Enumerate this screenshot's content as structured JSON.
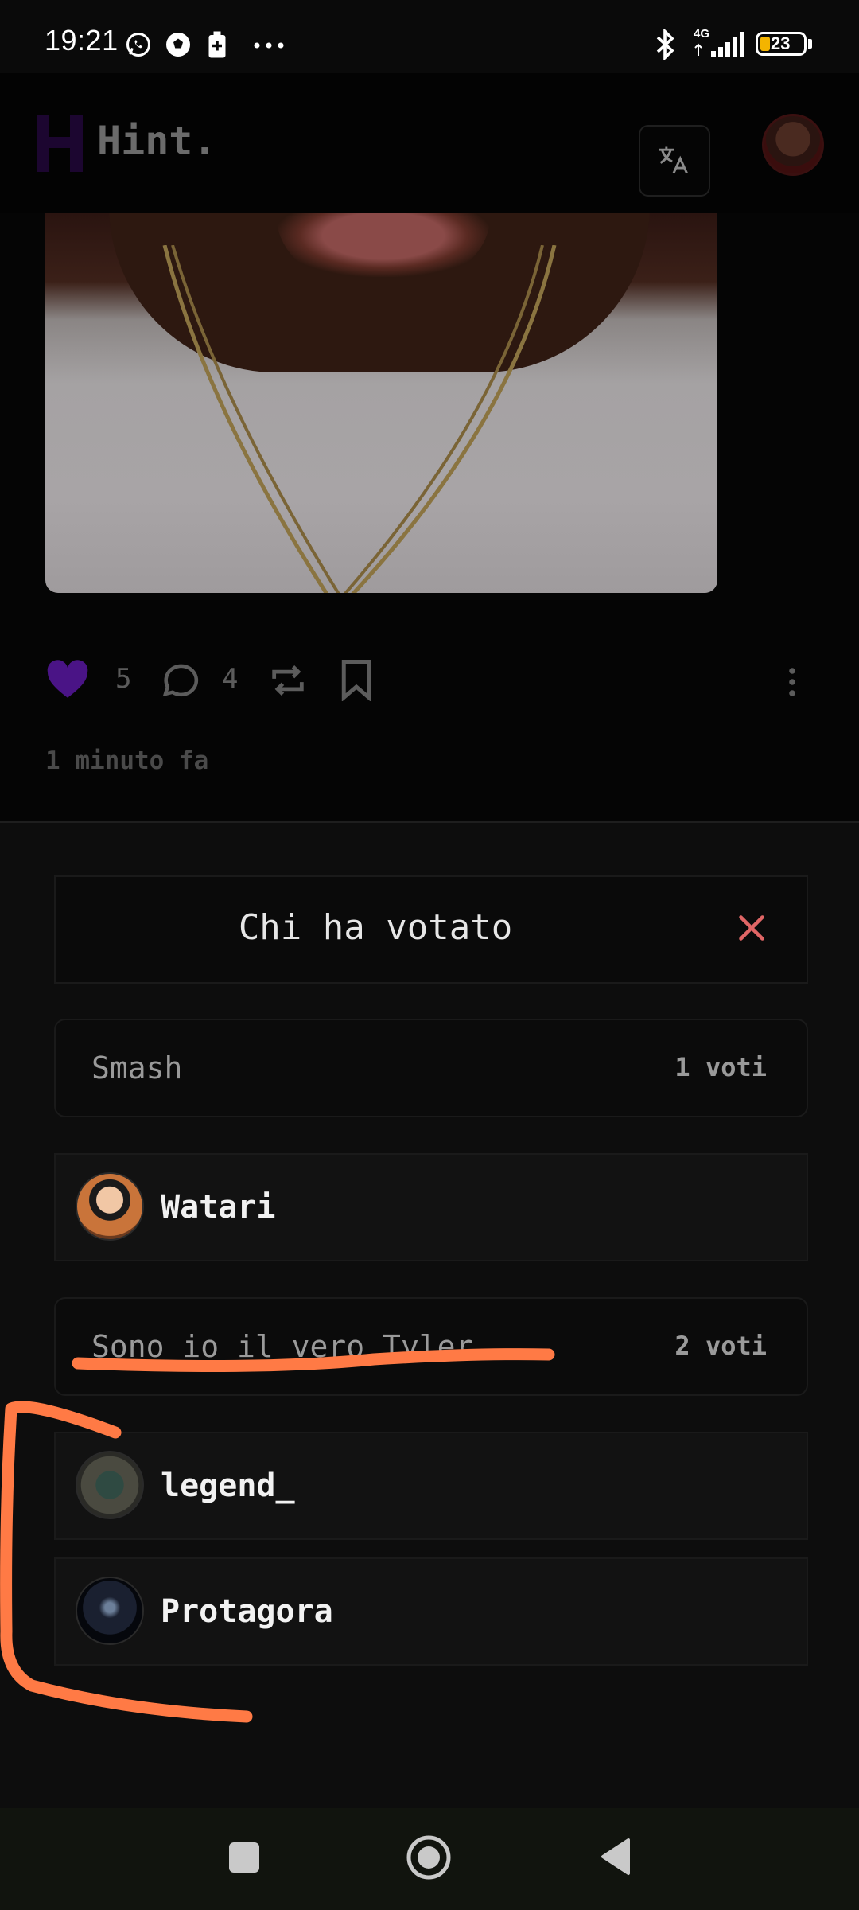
{
  "status_bar": {
    "time": "19:21",
    "network": "4G",
    "battery": "23"
  },
  "header": {
    "brand": "Hint."
  },
  "post": {
    "likes": "5",
    "comments": "4",
    "time_ago": "1 minuto fa"
  },
  "modal": {
    "title": "Chi ha votato",
    "options": [
      {
        "label": "Smash",
        "votes": "1 voti",
        "voters": [
          "Watari"
        ]
      },
      {
        "label": "Sono io il vero Tyler",
        "votes": "2 voti",
        "voters": [
          "legend_",
          "Protagora"
        ]
      }
    ]
  },
  "colors": {
    "accent": "#5b1a9e",
    "close": "#e06666",
    "annotation": "#ff7a45"
  }
}
